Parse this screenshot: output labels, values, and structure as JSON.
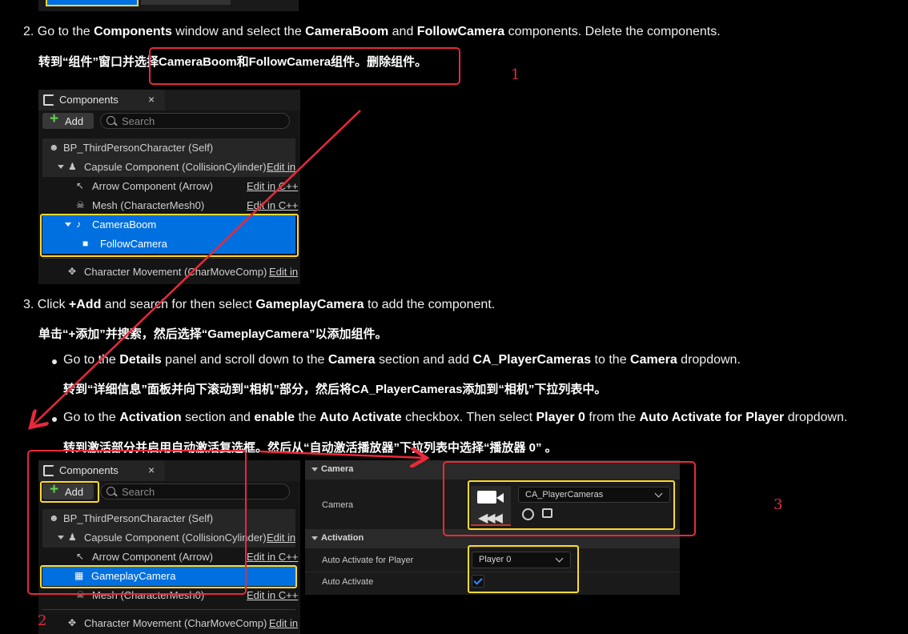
{
  "step2": {
    "num": "2.",
    "pre": "Go to the ",
    "b1": "Components",
    "mid1": " window and select the ",
    "b2": "CameraBoom",
    "mid2": " and ",
    "b3": "FollowCamera",
    "post": " components. Delete the components.",
    "zh_pre": "转到“",
    "zh_b1": "组件",
    "zh_mid": "”窗口并选择",
    "zh_b2": "CameraBoom",
    "zh_and": "和",
    "zh_b3": "FollowCamera",
    "zh_post": "组件。删除组件。"
  },
  "step3": {
    "num": "3.",
    "pre": "Click ",
    "b1": "+Add",
    "mid": " and search for then select ",
    "b2": "GameplayCamera",
    "post": " to add the component.",
    "zh": "单击“+添加”并搜索，然后选择“GameplayCamera”以添加组件。"
  },
  "bullet1": {
    "pre": "Go to the ",
    "b1": "Details",
    "mid1": " panel and scroll down to the ",
    "b2": "Camera",
    "mid2": " section and add ",
    "b3": "CA_PlayerCameras",
    "mid3": " to the ",
    "b4": "Camera",
    "post": " dropdown.",
    "zh": "转到“详细信息”面板并向下滚动到“相机”部分，然后将CA_PlayerCameras添加到“相机”下拉列表中。"
  },
  "bullet2": {
    "pre": "Go to the ",
    "b1": "Activation",
    "mid1": " section and ",
    "b2": "enable",
    "mid2": " the ",
    "b3": "Auto Activate",
    "mid3": " checkbox. Then select ",
    "b4": "Player 0",
    "mid4": " from the ",
    "b5": "Auto Activate for Player",
    "post": " dropdown.",
    "zh": "转到激活部分并启用自动激活复选框。然后从“自动激活播放器”下拉列表中选择“播放器 0” 。"
  },
  "panel": {
    "tab_label": "Components",
    "close": "×",
    "add_plus": "+",
    "add_label": "Add",
    "search_placeholder": "Search",
    "edit_in": "Edit in",
    "edit_in_cpp": "Edit in C++"
  },
  "panel1_rows": [
    "BP_ThirdPersonCharacter (Self)",
    "Capsule Component (CollisionCylinder)",
    "Arrow Component (Arrow)",
    "Mesh (CharacterMesh0)",
    "CameraBoom",
    "FollowCamera",
    "Character Movement (CharMoveComp)"
  ],
  "panel2_rows": [
    "BP_ThirdPersonCharacter (Self)",
    "Capsule Component (CollisionCylinder)",
    "Arrow Component (Arrow)",
    "GameplayCamera",
    "Mesh (CharacterMesh0)",
    "Character Movement (CharMoveComp)"
  ],
  "details": {
    "section_camera": "Camera",
    "prop_camera": "Camera",
    "camera_value": "CA_PlayerCameras",
    "section_activation": "Activation",
    "prop_auto_player": "Auto Activate for Player",
    "player_value": "Player 0",
    "prop_auto_activate": "Auto Activate"
  },
  "annotations": {
    "n1": "1",
    "n2": "2",
    "n3": "3"
  },
  "colors": {
    "selection": "#0070e0",
    "highlight_yellow": "#ffd92e",
    "annotation_red": "#e8293a",
    "add_plus_green": "#5fd34a"
  }
}
